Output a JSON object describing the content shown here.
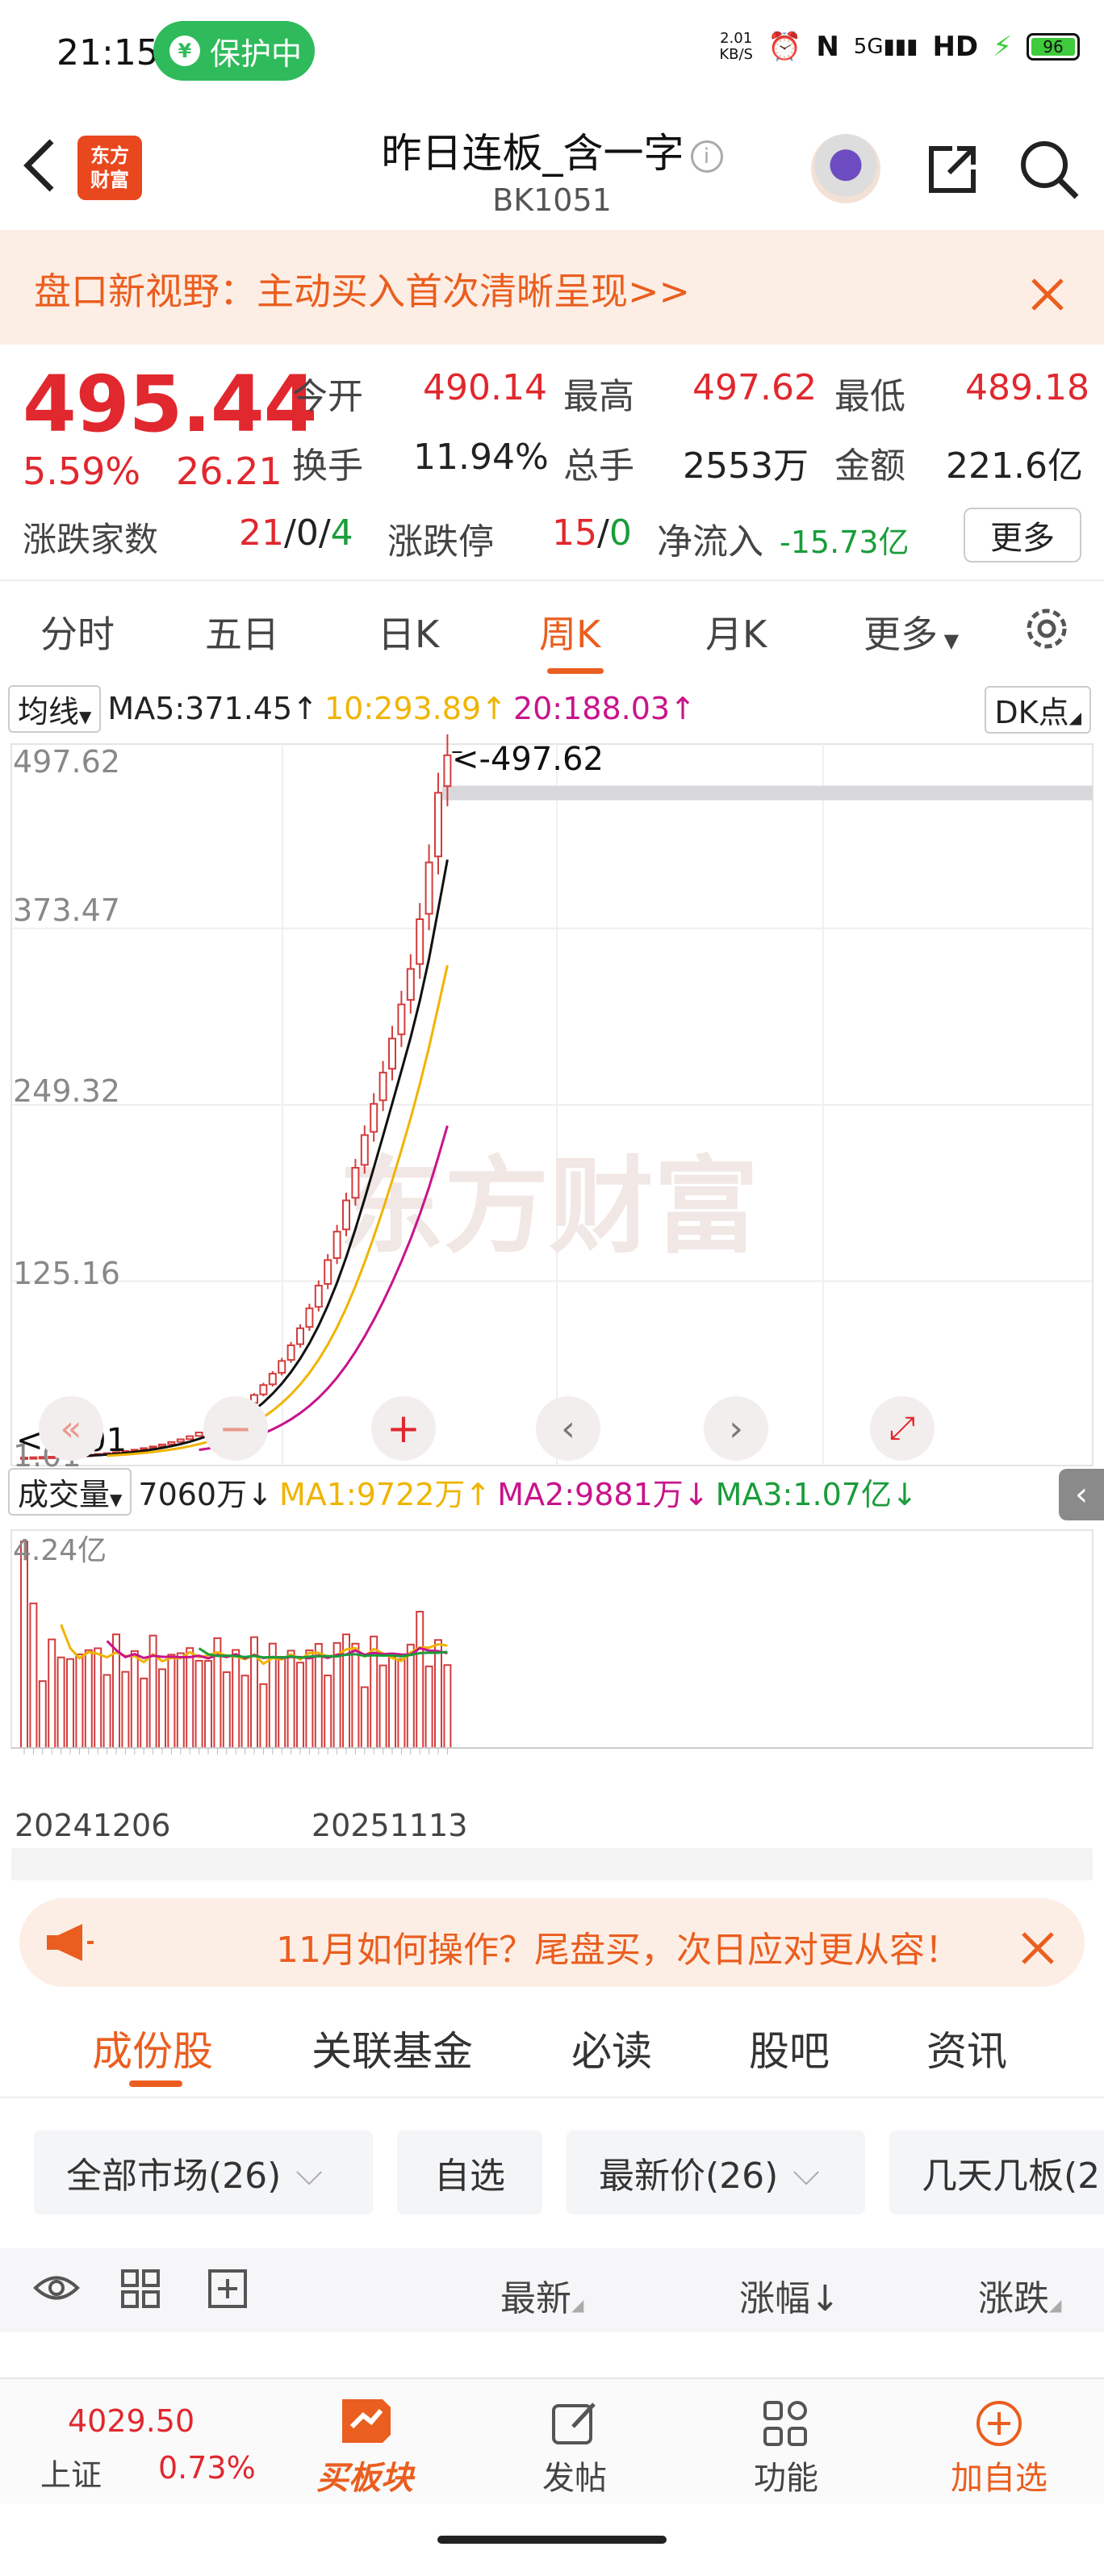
{
  "status_bar": {
    "time": "21:15",
    "protect_label": "保护中",
    "net_speed_value": "2.01",
    "net_speed_unit": "KB/S",
    "signal": "5G",
    "hd": "HD",
    "battery": "96"
  },
  "header": {
    "logo_line1": "东方",
    "logo_line2": "财富",
    "title": "昨日连板_含一字",
    "code": "BK1051"
  },
  "banner": {
    "text": "盘口新视野：主动买入首次清晰呈现>>"
  },
  "quote": {
    "price": "495.44",
    "pct": "5.59%",
    "change": "26.21",
    "open_label": "今开",
    "open": "490.14",
    "high_label": "最高",
    "high": "497.62",
    "low_label": "最低",
    "low": "489.18",
    "turnover_label": "换手",
    "turnover": "11.94%",
    "volume_label": "总手",
    "volume": "2553万",
    "amount_label": "金额",
    "amount": "221.6亿",
    "updown_label": "涨跌家数",
    "up": "21",
    "sep1": "/",
    "flat": "0",
    "sep2": "/",
    "down": "4",
    "limit_label": "涨跌停",
    "limit_up": "15",
    "sep3": "/",
    "limit_down": "0",
    "netflow_label": "净流入",
    "netflow": "-15.73亿",
    "more": "更多"
  },
  "period_tabs": [
    "分时",
    "五日",
    "日K",
    "周K",
    "月K",
    "更多"
  ],
  "chart": {
    "ma_button": "均线",
    "ma5": "MA5:371.45↑",
    "ma10": "10:293.89↑",
    "ma20": "20:188.03↑",
    "dk_button": "DK点",
    "y_labels": [
      "497.62",
      "373.47",
      "249.32",
      "125.16",
      "1.01"
    ],
    "max_marker": "<-497.62",
    "min_marker": "<-1.01",
    "watermark": "东方财富",
    "vol_button": "成交量",
    "vol": "7060万↓",
    "vma1": "MA1:9722万↑",
    "vma2": "MA2:9881万↓",
    "vma3": "MA3:1.07亿↓",
    "vol_max": "4.24亿",
    "date_start": "20241206",
    "date_end": "20251113",
    "colors": {
      "up": "#d33c3c",
      "ma5": "#111111",
      "ma10": "#f0b400",
      "ma20": "#c8148c",
      "vma3": "#1a9d3a"
    }
  },
  "chart_data": {
    "type": "candlestick",
    "ylim": [
      1.01,
      497.62
    ],
    "y_ticks": [
      497.62,
      373.47,
      249.32,
      125.16,
      1.01
    ],
    "closes": [
      1.0,
      1.2,
      1.4,
      1.6,
      1.9,
      2.2,
      2.6,
      3.0,
      3.5,
      4.1,
      4.8,
      5.6,
      6.5,
      7.6,
      8.8,
      10.2,
      11.9,
      13.8,
      16.0,
      18.6,
      21.6,
      25.0,
      29.0,
      33.6,
      39.0,
      45.0,
      52.0,
      60.0,
      69.0,
      80.0,
      92.0,
      106.0,
      122.0,
      140.0,
      160.0,
      182.0,
      205.0,
      228.0,
      250.0,
      272.0,
      296.0,
      320.0,
      345.0,
      380.0,
      420.0,
      469.0,
      495.44
    ],
    "ma_lines": {
      "ma5_end": 371.45,
      "ma10_end": 293.89,
      "ma20_end": 188.03
    }
  },
  "promo": {
    "text": "11月如何操作？尾盘买，次日应对更从容！"
  },
  "content_tabs": [
    "成份股",
    "关联基金",
    "必读",
    "股吧",
    "资讯"
  ],
  "filters": [
    "全部市场(26)",
    "自选",
    "最新价(26)",
    "几天几板(2"
  ],
  "list_header": {
    "latest": "最新",
    "change_pct": "涨幅↓",
    "change": "涨跌"
  },
  "bottom_nav": {
    "index_value": "4029.50",
    "index_name": "上证",
    "index_pct": "0.73%",
    "items": [
      "买板块",
      "发帖",
      "功能",
      "加自选"
    ]
  }
}
